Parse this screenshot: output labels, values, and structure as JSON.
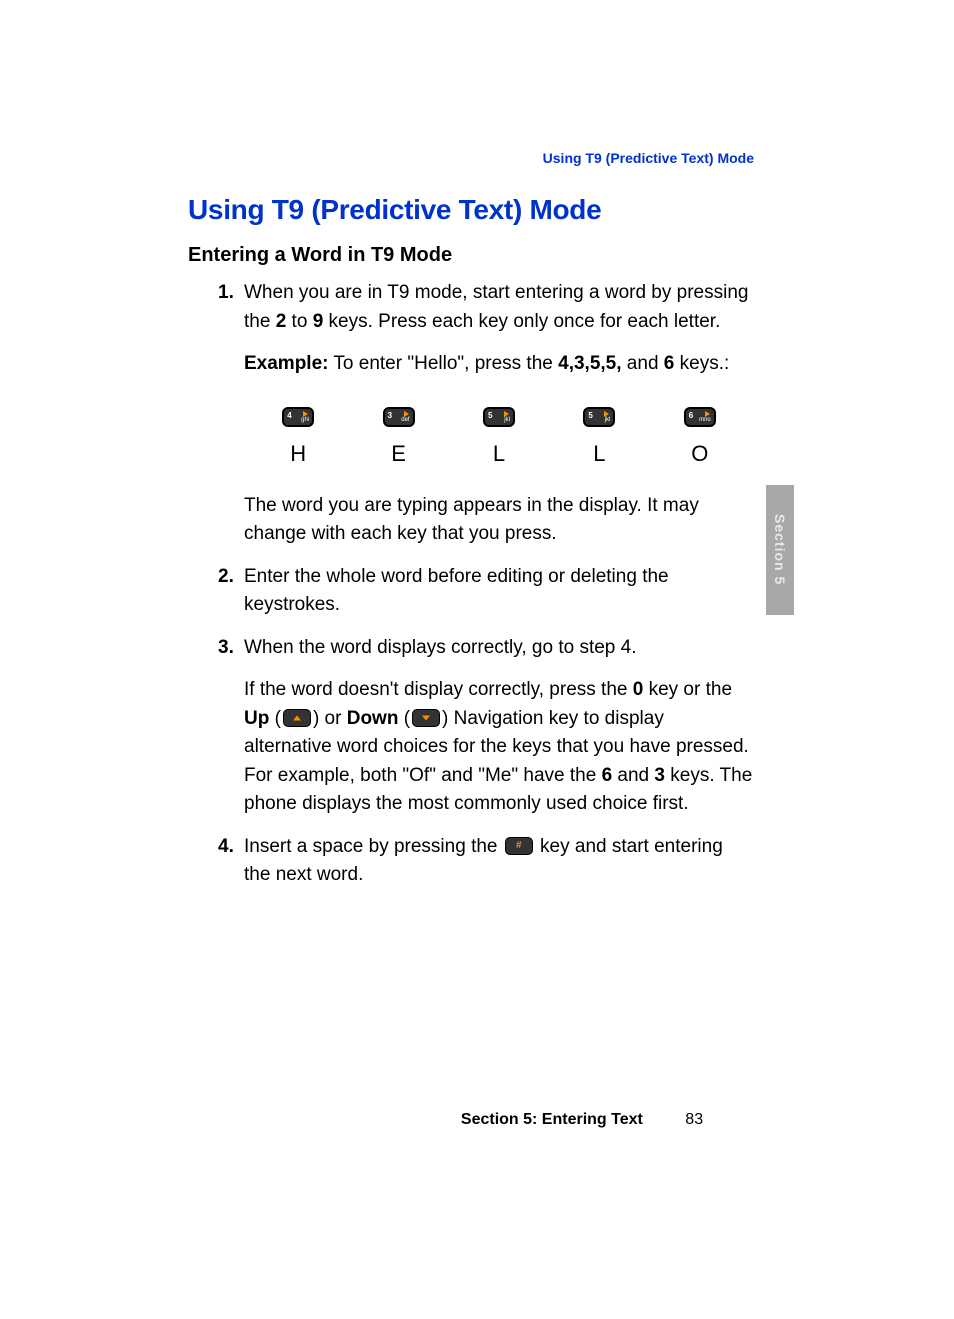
{
  "header": {
    "running": "Using T9 (Predictive Text) Mode"
  },
  "title": "Using T9 (Predictive Text) Mode",
  "subtitle": "Entering a Word in T9 Mode",
  "steps": {
    "n1": "1.",
    "s1_pre": "When you are in T9 mode, start entering a word by pressing the ",
    "s1_b1": "2",
    "s1_mid": " to ",
    "s1_b2": "9",
    "s1_post": " keys. Press each key only once for each letter.",
    "example_label": "Example:",
    "example_pre": " To enter \"Hello\", press the ",
    "example_keys": "4,3,5,5,",
    "example_and": " and ",
    "example_last": "6",
    "example_post": " keys.:",
    "keyrow": [
      {
        "num": "4",
        "letters": "ghi",
        "char": "H"
      },
      {
        "num": "3",
        "letters": "def",
        "char": "E"
      },
      {
        "num": "5",
        "letters": "jkl",
        "char": "L"
      },
      {
        "num": "5",
        "letters": "jkl",
        "char": "L"
      },
      {
        "num": "6",
        "letters": "mno",
        "char": "O"
      }
    ],
    "s1_after": "The word you are typing appears in the display. It may change with each key that you press.",
    "n2": "2.",
    "s2": "Enter the whole word before editing or deleting the keystrokes.",
    "n3": "3.",
    "s3": "When the word displays correctly, go to step 4.",
    "s3p2_pre": "If the word doesn't display correctly, press the ",
    "s3p2_b0": "0",
    "s3p2_mid1": " key or the ",
    "s3p2_up": "Up",
    "s3p2_mid2": " (",
    "s3p2_mid3": ") or ",
    "s3p2_down": "Down",
    "s3p2_mid4": " (",
    "s3p2_mid5": ") Navigation key to display alternative word choices for the keys that you have pressed.",
    "s3p3_pre": "For example, both \"Of\" and \"Me\" have the ",
    "s3p3_b6": "6",
    "s3p3_and": " and ",
    "s3p3_b3": "3",
    "s3p3_post": " keys. The phone displays the most commonly used choice first.",
    "n4": "4.",
    "s4_pre": "Insert a space by pressing the ",
    "s4_post": " key and start entering the next word."
  },
  "sidetab": "Section 5",
  "footer": {
    "section": "Section 5: Entering Text",
    "page": "83"
  }
}
